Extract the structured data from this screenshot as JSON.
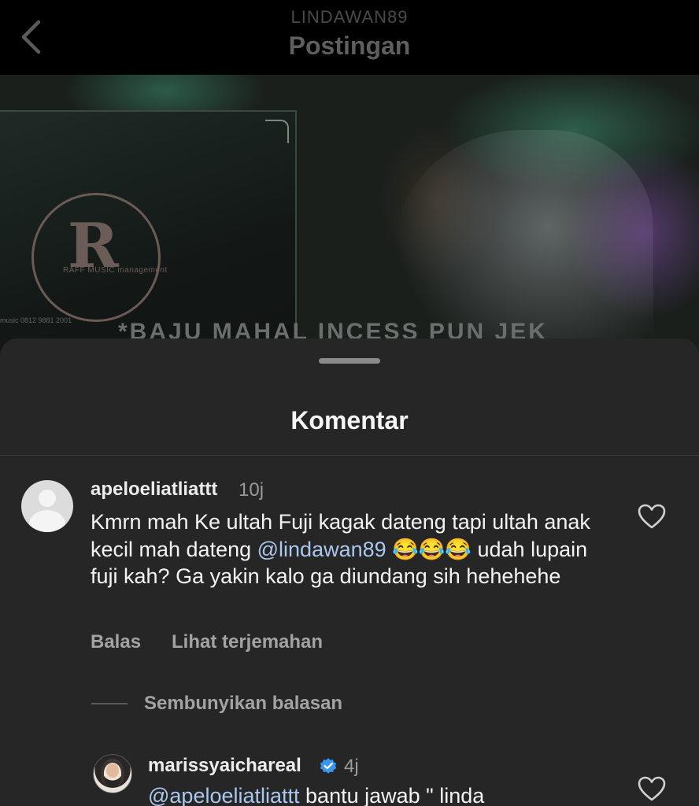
{
  "header": {
    "username": "LINDAWAN89",
    "title": "Postingan"
  },
  "post": {
    "logo_letter": "R",
    "logo_text": "RAFF MUSIC management",
    "contact_text": "music  0812 9881 2001",
    "caption": "*BAJU MAHAL INCESS PUN JEK"
  },
  "comments_sheet": {
    "title": "Komentar",
    "comment": {
      "username": "apeloeliatliattt",
      "time": "10j",
      "text_before_mention": "Kmrn mah Ke ultah Fuji kagak dateng tapi ultah anak kecil mah dateng ",
      "mention": "@lindawan89",
      "text_after_mention": " 😂😂😂 udah lupain fuji kah? Ga yakin kalo ga diundang sih hehehehe",
      "reply_label": "Balas",
      "translate_label": "Lihat terjemahan"
    },
    "hide_replies_label": "Sembunyikan balasan",
    "reply": {
      "username": "marissyaichareal",
      "verified": true,
      "time": "4j",
      "mention": "@apeloeliatliattt",
      "text": " bantu jawab \" linda"
    }
  },
  "colors": {
    "sheet_bg": "#262626",
    "mention": "#a9c7ef",
    "verified": "#3897f0"
  }
}
